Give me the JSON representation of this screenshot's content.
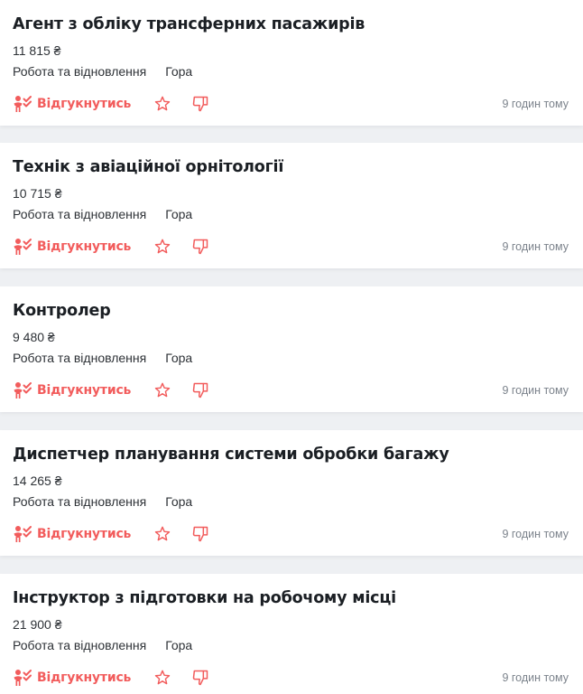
{
  "colors": {
    "accent": "#f25c5c",
    "text": "#1b1f24",
    "muted": "#7c838c",
    "background": "#eef0f3"
  },
  "vacancies": [
    {
      "title": "Агент з обліку трансферних пасажирів",
      "salary": "11 815 ₴",
      "company": "Робота та відновлення",
      "location": "Гора",
      "apply_label": "Відгукнутись",
      "time": "9 годин тому"
    },
    {
      "title": "Технік з авіаційної орнітології",
      "salary": "10 715 ₴",
      "company": "Робота та відновлення",
      "location": "Гора",
      "apply_label": "Відгукнутись",
      "time": "9 годин тому"
    },
    {
      "title": "Контролер",
      "salary": "9 480 ₴",
      "company": "Робота та відновлення",
      "location": "Гора",
      "apply_label": "Відгукнутись",
      "time": "9 годин тому"
    },
    {
      "title": "Диспетчер планування системи обробки багажу",
      "salary": "14 265 ₴",
      "company": "Робота та відновлення",
      "location": "Гора",
      "apply_label": "Відгукнутись",
      "time": "9 годин тому"
    },
    {
      "title": "Інструктор з підготовки на робочому місці",
      "salary": "21 900 ₴",
      "company": "Робота та відновлення",
      "location": "Гора",
      "apply_label": "Відгукнутись",
      "time": "9 годин тому"
    }
  ],
  "icons": {
    "apply": "person-check-icon",
    "favorite": "star-icon",
    "dislike": "thumbs-down-icon"
  }
}
